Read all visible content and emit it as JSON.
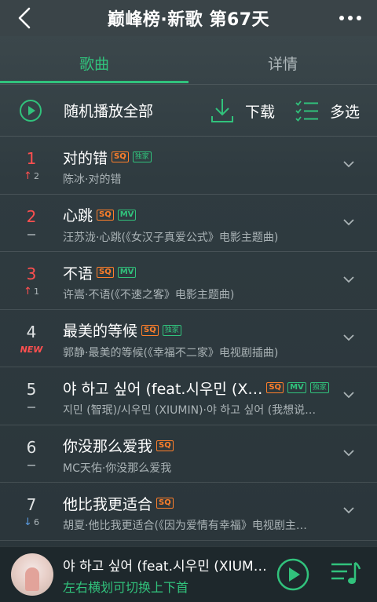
{
  "header": {
    "title": "巅峰榜·新歌 第67天"
  },
  "tabs": [
    {
      "label": "歌曲"
    },
    {
      "label": "详情"
    }
  ],
  "actions": {
    "play_all": "随机播放全部",
    "download": "下载",
    "multi_select": "多选"
  },
  "tags": {
    "sq": "SQ",
    "mv": "MV",
    "exclusive": "独家",
    "new": "NEW"
  },
  "songs": [
    {
      "rank": "1",
      "trend_num": "2",
      "title": "对的错",
      "subtitle": "陈冰·对的错"
    },
    {
      "rank": "2",
      "title": "心跳",
      "subtitle": "汪苏泷·心跳(《女汉子真爱公式》电影主题曲)"
    },
    {
      "rank": "3",
      "trend_num": "1",
      "title": "不语",
      "subtitle": "许嵩·不语(《不速之客》电影主题曲)"
    },
    {
      "rank": "4",
      "title": "最美的等候",
      "subtitle": "郭静·最美的等候(《幸福不二家》电视剧插曲)"
    },
    {
      "rank": "5",
      "title": "야 하고 싶어 (feat.시우민 (X…",
      "subtitle": "지민 (智珉)/시우민 (XIUMIN)·야 하고 싶어 (我想说…"
    },
    {
      "rank": "6",
      "title": "你没那么爱我",
      "subtitle": "MC天佑·你没那么爱我"
    },
    {
      "rank": "7",
      "trend_num": "6",
      "title": "他比我更适合",
      "subtitle": "胡夏·他比我更适合(《因为爱情有幸福》电视剧主…"
    }
  ],
  "player": {
    "now_playing": "야 하고 싶어 (feat.시우민 (XIUMIN))",
    "hint": "左右横划可切换上下首"
  },
  "colors": {
    "accent": "#31c27c",
    "rank_top": "#ff4f4f",
    "trend_down": "#5b9be0",
    "sq_tag": "#ff7f2a"
  }
}
